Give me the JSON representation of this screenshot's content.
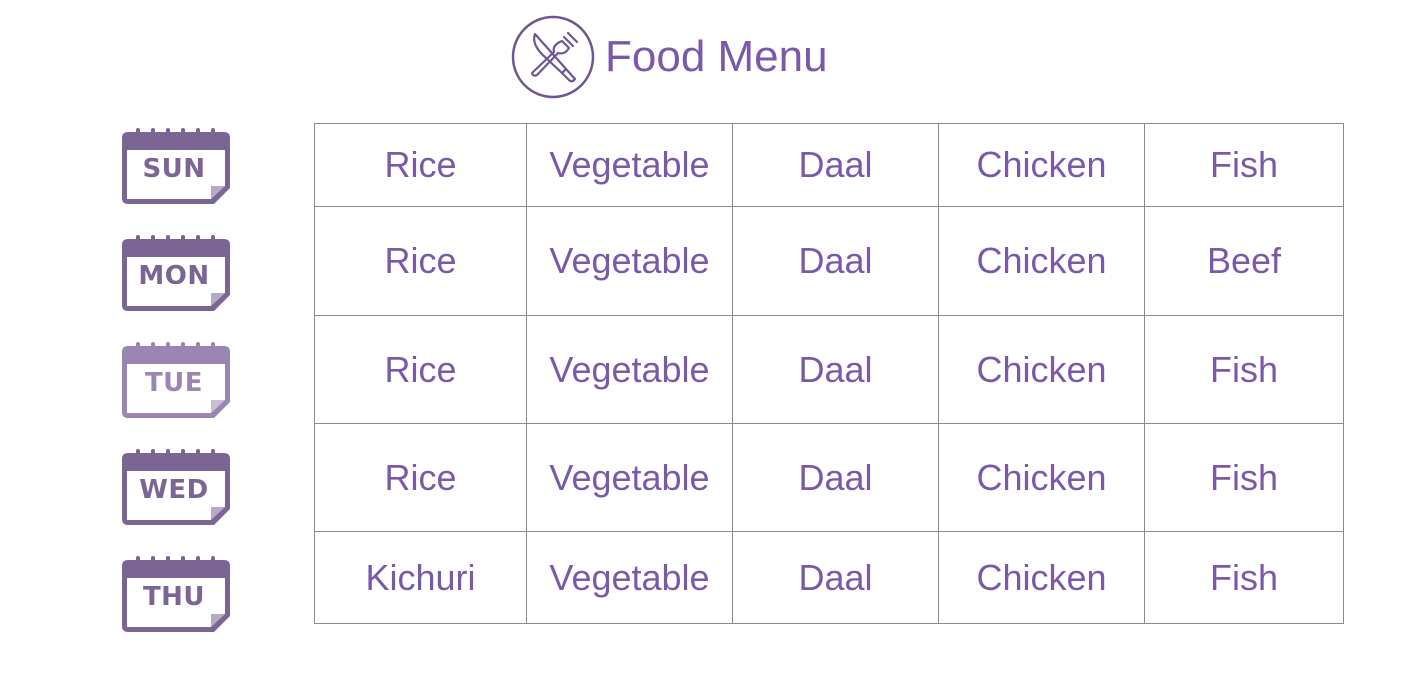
{
  "header": {
    "title": "Food Menu",
    "icon": "knife-fork-icon"
  },
  "colors": {
    "accent": "#7a5aa8",
    "calendar": "#7b6594",
    "calendar_light": "#9b86b3",
    "grid": "#8a8a8a"
  },
  "days": [
    {
      "label": "SUN",
      "items": [
        "Rice",
        "Vegetable",
        "Daal",
        "Chicken",
        "Fish"
      ]
    },
    {
      "label": "MON",
      "items": [
        "Rice",
        "Vegetable",
        "Daal",
        "Chicken",
        "Beef"
      ]
    },
    {
      "label": "TUE",
      "items": [
        "Rice",
        "Vegetable",
        "Daal",
        "Chicken",
        "Fish"
      ]
    },
    {
      "label": "WED",
      "items": [
        "Rice",
        "Vegetable",
        "Daal",
        "Chicken",
        "Fish"
      ]
    },
    {
      "label": "THU",
      "items": [
        "Kichuri",
        "Vegetable",
        "Daal",
        "Chicken",
        "Fish"
      ]
    }
  ]
}
